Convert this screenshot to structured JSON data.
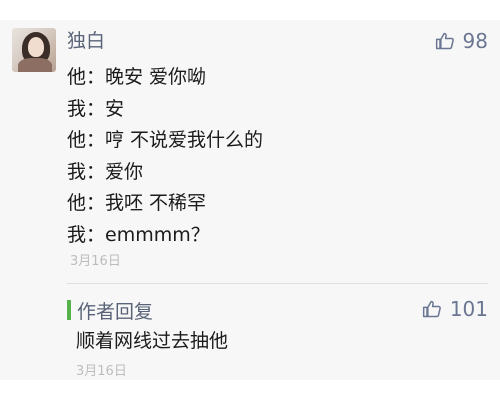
{
  "comment": {
    "username": "独白",
    "like_count": "98",
    "lines": [
      "他：晚安 爱你呦",
      "我：安",
      "他：哼 不说爱我什么的",
      "我：爱你",
      "他：我呸 不稀罕",
      "我：emmmm？"
    ],
    "date": "3月16日"
  },
  "reply": {
    "author_label": "作者回复",
    "like_count": "101",
    "text": "顺着网线过去抽他",
    "date": "3月16日"
  },
  "icons": {
    "like": "thumbs-up-icon"
  },
  "colors": {
    "name": "#5a6478",
    "author_bar": "#55b24a",
    "date": "#bdbdbd"
  }
}
